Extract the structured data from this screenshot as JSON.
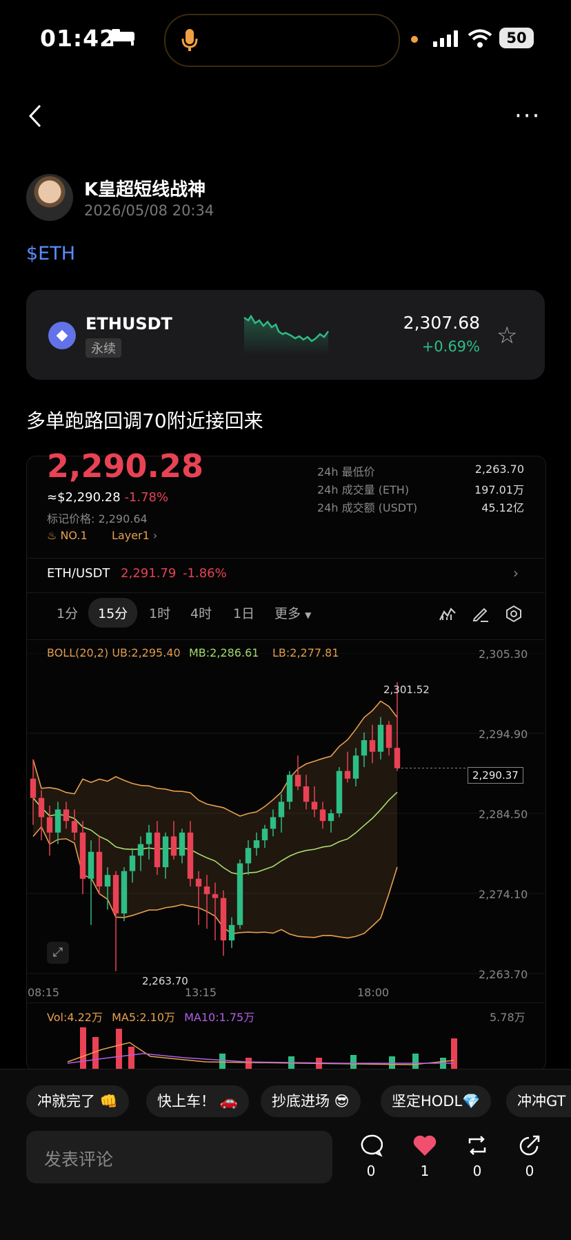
{
  "status_bar": {
    "time": "01:42",
    "battery": "50"
  },
  "post": {
    "author": "K皇超短线战神",
    "datetime": "2026/05/08 20:34",
    "tag": "$ETH",
    "text": "多单跑路回调70附近接回来"
  },
  "ticker_card": {
    "symbol": "ETHUSDT",
    "type_badge": "永续",
    "price": "2,307.68",
    "change": "+0.69%"
  },
  "screenshot": {
    "last_price": "2,290.28",
    "approx_usd": "≈$2,290.28",
    "pct": "-1.78%",
    "mark_price": "标记价格: 2,290.64",
    "rank": "NO.1",
    "sector": "Layer1",
    "stats": [
      {
        "label": "24h 最低价",
        "value": "2,263.70"
      },
      {
        "label": "24h 成交量 (ETH)",
        "value": "197.01万"
      },
      {
        "label": "24h 成交额 (USDT)",
        "value": "45.12亿"
      }
    ],
    "pair": "ETH/USDT",
    "pair_price": "2,291.79",
    "pair_change": "-1.86%",
    "timeframes": [
      "1分",
      "15分",
      "1时",
      "4时",
      "1日",
      "更多"
    ],
    "selected_timeframe": "15分",
    "boll": {
      "label": "BOLL(20,2)",
      "ub": "UB:2,295.40",
      "mb": "MB:2,286.61",
      "lb": "LB:2,277.81"
    },
    "high_label": "2,301.52",
    "low_label": "2,263.70",
    "current_label": "2,290.37",
    "y_ticks": [
      "2,305.30",
      "2,294.90",
      "2,284.50",
      "2,274.10",
      "2,263.70"
    ],
    "x_ticks": [
      "08:15",
      "13:15",
      "18:00"
    ],
    "volume": {
      "vol": "Vol:4.22万",
      "ma5": "MA5:2.10万",
      "ma10": "MA10:1.75万",
      "max": "5.78万"
    },
    "colors": {
      "up": "#2ebd85",
      "down": "#e94255",
      "boll_band": "#e8a050",
      "mb": "#a8e070"
    }
  },
  "chart_data": {
    "type": "candlestick",
    "interval": "15分",
    "ylim": [
      2263.7,
      2305.3
    ],
    "y_ticks": [
      2305.3,
      2294.9,
      2284.5,
      2274.1,
      2263.7
    ],
    "x_ticks": [
      "08:15",
      "13:15",
      "18:00"
    ],
    "ohlc": [
      [
        2289.0,
        2291.5,
        2283.0,
        2286.5
      ],
      [
        2286.5,
        2287.5,
        2281.0,
        2284.0
      ],
      [
        2284.0,
        2285.5,
        2279.0,
        2282.0
      ],
      [
        2282.0,
        2286.0,
        2280.5,
        2285.0
      ],
      [
        2285.0,
        2286.0,
        2282.5,
        2283.5
      ],
      [
        2283.5,
        2285.0,
        2281.0,
        2282.0
      ],
      [
        2282.0,
        2283.5,
        2274.0,
        2276.0
      ],
      [
        2276.0,
        2281.0,
        2270.0,
        2279.5
      ],
      [
        2279.5,
        2281.5,
        2274.0,
        2275.0
      ],
      [
        2275.0,
        2277.5,
        2272.0,
        2276.5
      ],
      [
        2276.5,
        2277.0,
        2264.0,
        2271.5
      ],
      [
        2271.5,
        2277.5,
        2270.5,
        2277.0
      ],
      [
        2277.0,
        2280.0,
        2275.5,
        2279.0
      ],
      [
        2279.0,
        2281.5,
        2277.0,
        2280.5
      ],
      [
        2280.5,
        2283.0,
        2278.5,
        2282.0
      ],
      [
        2282.0,
        2283.5,
        2276.5,
        2277.5
      ],
      [
        2277.5,
        2282.0,
        2276.0,
        2281.5
      ],
      [
        2281.5,
        2283.5,
        2278.5,
        2279.0
      ],
      [
        2279.0,
        2282.5,
        2278.0,
        2282.0
      ],
      [
        2282.0,
        2283.5,
        2275.0,
        2276.0
      ],
      [
        2276.0,
        2277.0,
        2270.0,
        2275.0
      ],
      [
        2275.0,
        2276.5,
        2269.5,
        2274.0
      ],
      [
        2274.0,
        2275.5,
        2268.0,
        2273.5
      ],
      [
        2273.5,
        2274.5,
        2266.0,
        2268.0
      ],
      [
        2268.0,
        2271.0,
        2267.0,
        2270.0
      ],
      [
        2270.0,
        2278.5,
        2269.5,
        2278.0
      ],
      [
        2278.0,
        2281.0,
        2276.5,
        2280.0
      ],
      [
        2280.0,
        2282.0,
        2279.0,
        2281.0
      ],
      [
        2281.0,
        2283.0,
        2280.0,
        2282.5
      ],
      [
        2282.5,
        2285.0,
        2281.5,
        2284.0
      ],
      [
        2284.0,
        2287.0,
        2282.0,
        2286.0
      ],
      [
        2286.0,
        2290.0,
        2285.0,
        2289.5
      ],
      [
        2289.5,
        2292.0,
        2287.5,
        2288.0
      ],
      [
        2288.0,
        2289.5,
        2285.0,
        2286.0
      ],
      [
        2286.0,
        2288.0,
        2284.0,
        2285.0
      ],
      [
        2285.0,
        2286.0,
        2282.5,
        2283.5
      ],
      [
        2283.5,
        2285.0,
        2282.0,
        2284.5
      ],
      [
        2284.5,
        2290.5,
        2284.0,
        2290.0
      ],
      [
        2290.0,
        2292.5,
        2288.5,
        2289.0
      ],
      [
        2289.0,
        2293.0,
        2288.0,
        2292.0
      ],
      [
        2292.0,
        2295.0,
        2290.5,
        2294.0
      ],
      [
        2294.0,
        2296.0,
        2291.0,
        2292.5
      ],
      [
        2292.5,
        2297.0,
        2291.5,
        2296.0
      ],
      [
        2296.0,
        2296.5,
        2292.0,
        2293.0
      ],
      [
        2293.0,
        2301.52,
        2290.0,
        2290.37
      ]
    ]
  },
  "reactions": [
    {
      "label": "冲就完了 👊"
    },
    {
      "label": "快上车！ 🚗"
    },
    {
      "label": "抄底进场 😎"
    },
    {
      "label": "坚定HODL💎"
    },
    {
      "label": "冲冲GT"
    }
  ],
  "comment_input": {
    "placeholder": "发表评论"
  },
  "actions": [
    {
      "icon": "comment-icon",
      "count": "0"
    },
    {
      "icon": "heart-icon",
      "count": "1",
      "color": "#f0506e"
    },
    {
      "icon": "repost-icon",
      "count": "0"
    },
    {
      "icon": "share-icon",
      "count": "0"
    }
  ]
}
